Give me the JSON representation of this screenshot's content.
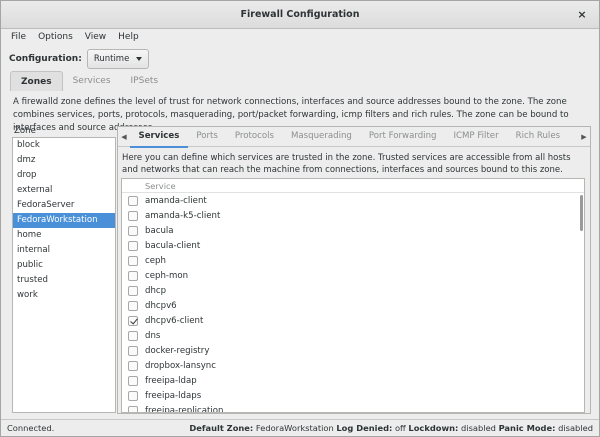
{
  "window": {
    "title": "Firewall Configuration",
    "close_glyph": "×"
  },
  "menu": [
    "File",
    "Options",
    "View",
    "Help"
  ],
  "config": {
    "label": "Configuration:",
    "value": "Runtime"
  },
  "main_tabs": [
    "Zones",
    "Services",
    "IPSets"
  ],
  "zone_description": "A firewalld zone defines the level of trust for network connections, interfaces and source addresses bound to the zone. The zone combines services, ports, protocols, masquerading, port/packet forwarding, icmp filters and rich rules. The zone can be bound to interfaces and source addresses.",
  "zone_heading": "Zone",
  "zones": [
    "block",
    "dmz",
    "drop",
    "external",
    "FedoraServer",
    "FedoraWorkstation",
    "home",
    "internal",
    "public",
    "trusted",
    "work"
  ],
  "selected_zone": "FedoraWorkstation",
  "sub_tabs": [
    "Services",
    "Ports",
    "Protocols",
    "Masquerading",
    "Port Forwarding",
    "ICMP Filter",
    "Rich Rules"
  ],
  "services_description": "Here you can define which services are trusted in the zone. Trusted services are accessible from all hosts and networks that can reach the machine from connections, interfaces and sources bound to this zone.",
  "services_header": "Service",
  "services": [
    {
      "name": "amanda-client",
      "checked": false
    },
    {
      "name": "amanda-k5-client",
      "checked": false
    },
    {
      "name": "bacula",
      "checked": false
    },
    {
      "name": "bacula-client",
      "checked": false
    },
    {
      "name": "ceph",
      "checked": false
    },
    {
      "name": "ceph-mon",
      "checked": false
    },
    {
      "name": "dhcp",
      "checked": false
    },
    {
      "name": "dhcpv6",
      "checked": false
    },
    {
      "name": "dhcpv6-client",
      "checked": true
    },
    {
      "name": "dns",
      "checked": false
    },
    {
      "name": "docker-registry",
      "checked": false
    },
    {
      "name": "dropbox-lansync",
      "checked": false
    },
    {
      "name": "freeipa-ldap",
      "checked": false
    },
    {
      "name": "freeipa-ldaps",
      "checked": false
    },
    {
      "name": "freeipa-replication",
      "checked": false
    }
  ],
  "status": {
    "connection": "Connected.",
    "default_zone_label": "Default Zone:",
    "default_zone": "FedoraWorkstation",
    "log_denied_label": "Log Denied:",
    "log_denied": "off",
    "lockdown_label": "Lockdown:",
    "lockdown": "disabled",
    "panic_label": "Panic Mode:",
    "panic": "disabled"
  },
  "colors": {
    "selection": "#4a90d9",
    "window_bg": "#ededed"
  }
}
